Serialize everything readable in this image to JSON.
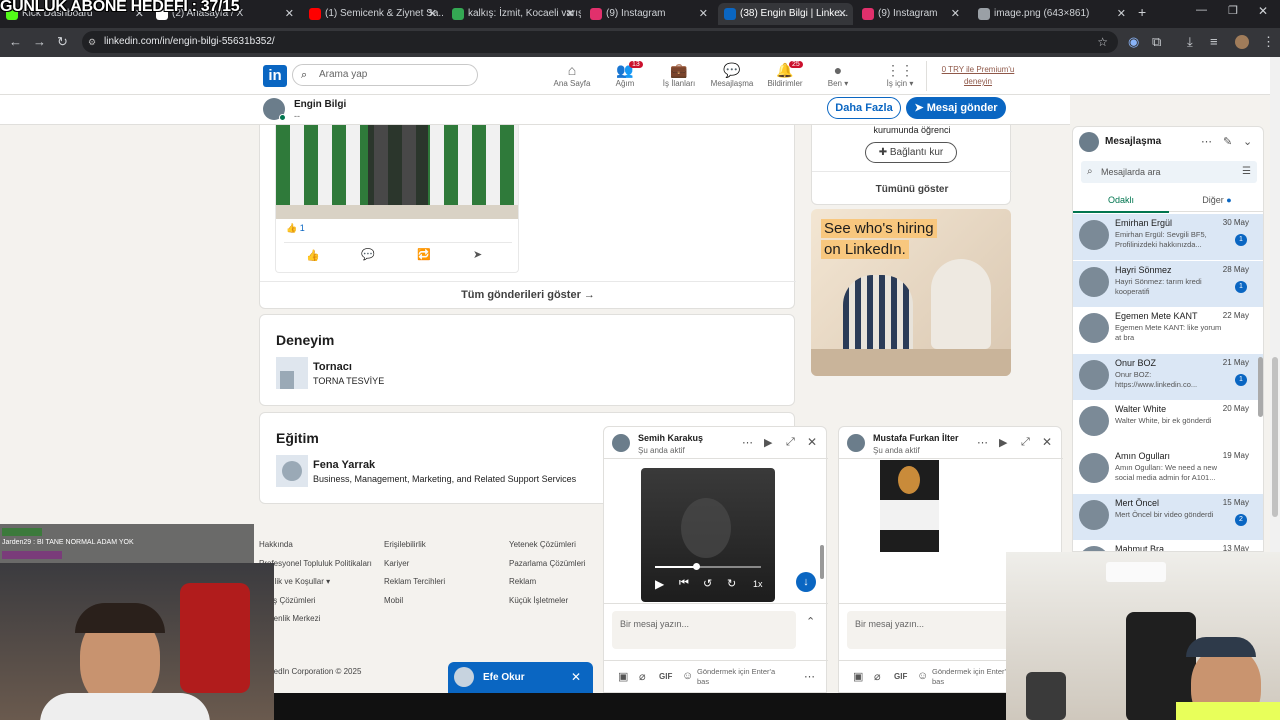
{
  "overlay": {
    "stream_title": "GÜNLÜK ABONE HEDEFİ : 37/15"
  },
  "browser": {
    "tabs": [
      {
        "label": "Kick Dashboard",
        "icon": "kick-icon",
        "color": "#53fc18"
      },
      {
        "label": "(2) Anasayfa / X",
        "icon": "x-icon",
        "color": "#ffffff"
      },
      {
        "label": "(1) Semicenk & Ziynet Sa...",
        "icon": "youtube-icon",
        "color": "#ff0000"
      },
      {
        "label": "kalkış: İzmit, Kocaeli varış...",
        "icon": "maps-icon",
        "color": "#34a853"
      },
      {
        "label": "(9) Instagram",
        "icon": "instagram-icon",
        "color": "#e1306c"
      },
      {
        "label": "(38) Engin Bilgi | Linke...",
        "icon": "linkedin-icon",
        "color": "#0a66c2"
      },
      {
        "label": "(9) Instagram",
        "icon": "instagram-icon",
        "color": "#e1306c"
      },
      {
        "label": "image.png (643×861)",
        "icon": "globe-icon",
        "color": "#9aa0a6"
      }
    ],
    "url": "linkedin.com/in/engin-bilgi-55631b352/"
  },
  "linkedin": {
    "search_placeholder": "Arama yap",
    "nav": [
      {
        "label": "Ana Sayfa",
        "icon": "home-icon",
        "badge": ""
      },
      {
        "label": "Ağım",
        "icon": "network-icon",
        "badge": "13"
      },
      {
        "label": "İş İlanları",
        "icon": "jobs-icon",
        "badge": ""
      },
      {
        "label": "Mesajlaşma",
        "icon": "messaging-icon",
        "badge": ""
      },
      {
        "label": "Bildirimler",
        "icon": "bell-icon",
        "badge": "25"
      },
      {
        "label": "Ben ▾",
        "icon": "profile-avatar",
        "badge": ""
      },
      {
        "label": "İş için ▾",
        "icon": "grid-icon",
        "badge": ""
      }
    ],
    "premium": "0 TRY ile Premium'u deneyin",
    "profile": {
      "name": "Engin Bilgi",
      "sub": "--"
    },
    "buttons": {
      "more": "Daha Fazla",
      "message": "Mesaj gönder"
    },
    "post": {
      "likes": "1",
      "all_posts": "Tüm gönderileri göster →"
    },
    "experience": {
      "title": "Deneyim",
      "role": "Tornacı",
      "company": "TORNA TESVİYE"
    },
    "education": {
      "title": "Eğitim",
      "school": "Fena Yarrak",
      "field": "Business, Management, Marketing, and Related Support Services"
    },
    "sidebar": {
      "snippet": "kurumunda öğrenci",
      "connect": "Bağlantı kur",
      "show_all": "Tümünü göster",
      "ad_line1": "See who's hiring",
      "ad_line2": "on LinkedIn."
    },
    "footer": {
      "col1": [
        "Hakkında",
        "Profesyonel Topluluk Politikaları",
        "Gizlilik ve Koşullar ▾",
        "Satış Çözümleri",
        "Güvenlik Merkezi"
      ],
      "col2": [
        "Erişilebilirlik",
        "Kariyer",
        "Reklam Tercihleri",
        "Mobil"
      ],
      "col3": [
        "Yetenek Çözümleri",
        "Pazarlama Çözümleri",
        "Reklam",
        "Küçük İşletmeler"
      ],
      "copyright": "LinkedIn Corporation © 2025"
    }
  },
  "messaging": {
    "title": "Mesajlaşma",
    "search_placeholder": "Mesajlarda ara",
    "tabs": [
      "Odaklı",
      "Diğer"
    ],
    "conversations": [
      {
        "name": "Emirhan Ergül",
        "date": "30 May",
        "preview": "Emirhan Ergül: Sevgili BF5, Profilinizdeki hakkınızda...",
        "unread": "1"
      },
      {
        "name": "Hayri Sönmez",
        "date": "28 May",
        "preview": "Hayri Sönmez: tarım kredi kooperatifi",
        "unread": "1"
      },
      {
        "name": "Egemen Mete KANT",
        "date": "22 May",
        "preview": "Egemen Mete KANT: like yorum at bra",
        "unread": ""
      },
      {
        "name": "Onur BOZ",
        "date": "21 May",
        "preview": "Onur BOZ: https://www.linkedin.co...",
        "unread": "1"
      },
      {
        "name": "Walter White",
        "date": "20 May",
        "preview": "Walter White, bir ek gönderdi",
        "unread": ""
      },
      {
        "name": "Amın Ogulları",
        "date": "19 May",
        "preview": "Amın Ogulları: We need a new social media admin for A101...",
        "unread": ""
      },
      {
        "name": "Mert Öncel",
        "date": "15 May",
        "preview": "Mert Öncel bir video gönderdi",
        "unread": "2"
      },
      {
        "name": "Mahmut Bra",
        "date": "13 May",
        "preview": "",
        "unread": ""
      }
    ]
  },
  "chats": [
    {
      "name": "Semih Karakuş",
      "status": "Şu anda aktif",
      "placeholder": "Bir mesaj yazın...",
      "hint": "Göndermek için Enter'a bas",
      "speed": "1x"
    },
    {
      "name": "Mustafa Furkan İlter",
      "status": "Şu anda aktif",
      "placeholder": "Bir mesaj yazın...",
      "hint": "Göndermek için Enter'a bas"
    }
  ],
  "minimized_chat": {
    "name": "Efe Okur"
  },
  "stream_chat": [
    {
      "text": "Jarden29 : BI TANE NORMAL ADAM YOK"
    }
  ]
}
